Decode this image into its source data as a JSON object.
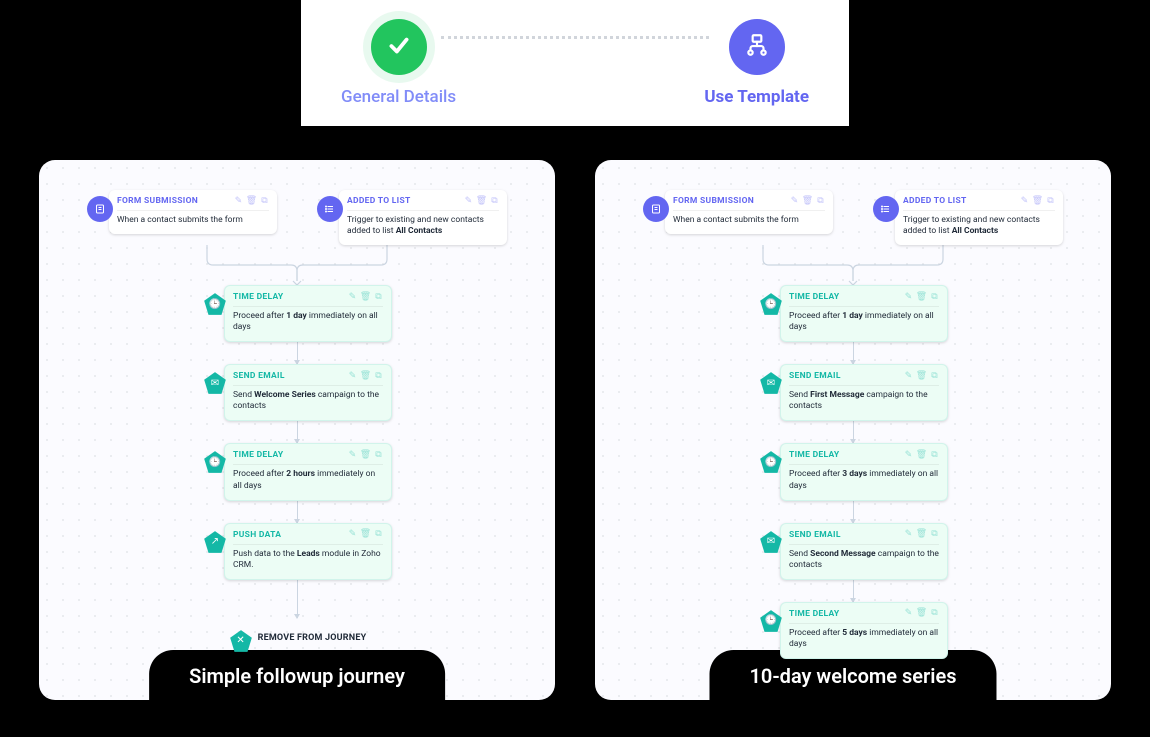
{
  "stepper": {
    "step1": {
      "label": "General Details",
      "state": "done"
    },
    "step2": {
      "label": "Use Template",
      "state": "active"
    }
  },
  "journeys": [
    {
      "caption": "Simple followup  journey",
      "triggers": [
        {
          "title": "FORM SUBMISSION",
          "body_pre": "When a contact submits the form",
          "bold": "",
          "body_post": ""
        },
        {
          "title": "ADDED TO LIST",
          "body_pre": "Trigger to existing and new contacts added to list ",
          "bold": "All Contacts",
          "body_post": ""
        }
      ],
      "steps": [
        {
          "type": "delay",
          "title": "TIME DELAY",
          "body_pre": "Proceed after ",
          "bold": "1 day",
          "body_post": " immediately on all days"
        },
        {
          "type": "email",
          "title": "SEND EMAIL",
          "body_pre": "Send ",
          "bold": "Welcome Series",
          "body_post": " campaign to the contacts"
        },
        {
          "type": "delay",
          "title": "TIME DELAY",
          "body_pre": "Proceed after ",
          "bold": "2 hours",
          "body_post": " immediately on all days"
        },
        {
          "type": "push",
          "title": "PUSH DATA",
          "body_pre": "Push data to the ",
          "bold": "Leads",
          "body_post": " module in Zoho CRM."
        }
      ],
      "end": "REMOVE FROM JOURNEY"
    },
    {
      "caption": "10-day welcome series",
      "triggers": [
        {
          "title": "FORM SUBMISSION",
          "body_pre": "When a contact submits the form",
          "bold": "",
          "body_post": ""
        },
        {
          "title": "ADDED TO LIST",
          "body_pre": "Trigger to existing and new contacts added to list ",
          "bold": "All Contacts",
          "body_post": ""
        }
      ],
      "steps": [
        {
          "type": "delay",
          "title": "TIME DELAY",
          "body_pre": "Proceed after ",
          "bold": "1 day",
          "body_post": " immediately on all days"
        },
        {
          "type": "email",
          "title": "SEND EMAIL",
          "body_pre": "Send ",
          "bold": "First Message",
          "body_post": " campaign to the contacts"
        },
        {
          "type": "delay",
          "title": "TIME DELAY",
          "body_pre": "Proceed after ",
          "bold": "3 days",
          "body_post": " immediately on all days"
        },
        {
          "type": "email",
          "title": "SEND EMAIL",
          "body_pre": "Send ",
          "bold": "Second Message",
          "body_post": " campaign to the contacts"
        },
        {
          "type": "delay",
          "title": "TIME DELAY",
          "body_pre": "Proceed after ",
          "bold": "5 days",
          "body_post": " immediately on all days"
        }
      ],
      "end": null
    }
  ]
}
